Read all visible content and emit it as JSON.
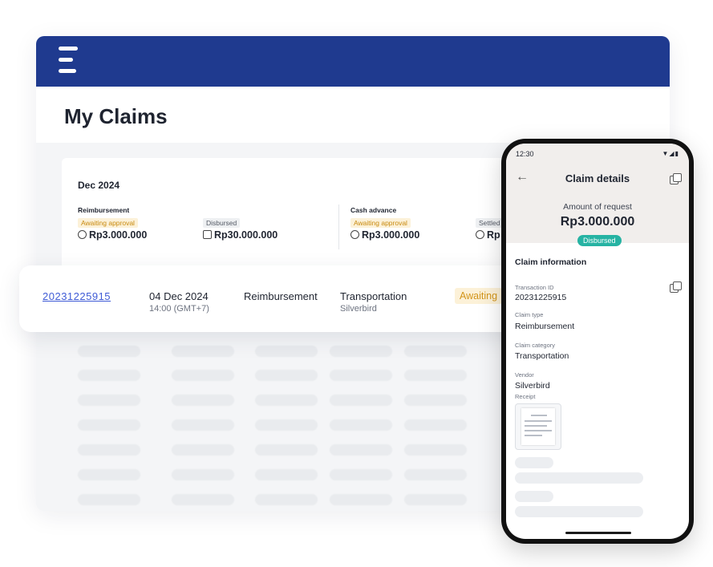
{
  "page": {
    "title": "My Claims"
  },
  "summary": {
    "period": "Dec 2024",
    "groups": [
      {
        "label": "Reimbursement",
        "stats": [
          {
            "badge": "Awaiting approval",
            "amount": "Rp3.000.000",
            "icon": "coin-icon"
          },
          {
            "badge": "Disbursed",
            "amount": "Rp30.000.000",
            "icon": "document-icon"
          }
        ]
      },
      {
        "label": "Cash advance",
        "stats": [
          {
            "badge": "Awaiting approval",
            "amount": "Rp3.000.000",
            "icon": "coin-icon"
          },
          {
            "badge": "Settled",
            "amount": "Rp",
            "icon": "settled-icon"
          }
        ]
      }
    ]
  },
  "claim_row": {
    "id": "20231225915",
    "date": "04 Dec 2024",
    "time": "14:00 (GMT+7)",
    "type": "Reimbursement",
    "category": "Transportation",
    "vendor": "Silverbird",
    "status": "Awaiting"
  },
  "phone": {
    "status_time": "12:30",
    "status_icons": "wifi-signal-battery-icons",
    "title": "Claim details",
    "amount_label": "Amount of request",
    "amount_value": "Rp3.000.000",
    "status": "Disbursed",
    "section_title": "Claim information",
    "fields": [
      {
        "label": "Transaction ID",
        "value": "20231225915"
      },
      {
        "label": "Claim type",
        "value": "Reimbursement"
      },
      {
        "label": "Claim category",
        "value": "Transportation"
      },
      {
        "label": "Vendor",
        "value": "Silverbird"
      }
    ],
    "receipt_label": "Receipt"
  },
  "colors": {
    "topbar": "#1f3a8f",
    "link": "#3f5bd6",
    "awaiting_bg": "#fcf1d8",
    "awaiting_text": "#d29419",
    "disbursed_pill": "#26b3a3"
  }
}
